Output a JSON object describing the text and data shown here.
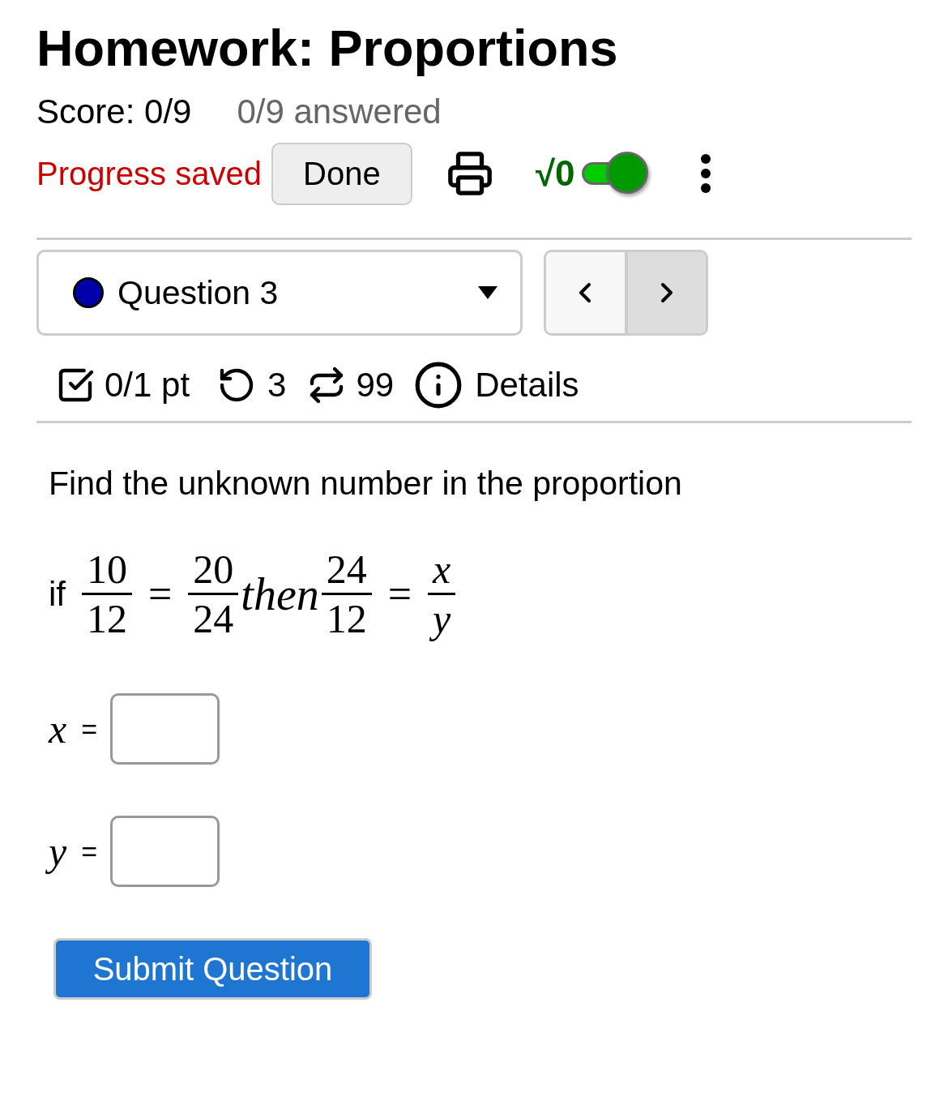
{
  "header": {
    "title": "Homework: Proportions",
    "score": "Score: 0/9",
    "answered": "0/9 answered"
  },
  "toolbar": {
    "status": "Progress saved",
    "done_button": "Done",
    "math_toggle": {
      "label": "√0",
      "on": true
    }
  },
  "question_nav": {
    "dropdown": {
      "label": "Question 3",
      "color": "#0000aa"
    }
  },
  "question_info": {
    "points": "0/1 pt",
    "retries": "3",
    "attempts": "99",
    "details": "Details"
  },
  "question": {
    "prompt": "Find the unknown number in the proportion",
    "expression": [
      {
        "kind": "text",
        "text": "if"
      },
      {
        "kind": "fraction",
        "numerator": "10",
        "denominator": "12"
      },
      {
        "kind": "operator",
        "text": "="
      },
      {
        "kind": "fraction",
        "numerator": "20",
        "denominator": "24"
      },
      {
        "kind": "italic_text",
        "text": "then"
      },
      {
        "kind": "fraction",
        "numerator": "24",
        "denominator": "12"
      },
      {
        "kind": "operator",
        "text": "="
      },
      {
        "kind": "variable_fraction",
        "numerator": "x",
        "denominator": "y"
      }
    ],
    "answers": [
      {
        "variable": "x",
        "sign": "="
      },
      {
        "variable": "y",
        "sign": "="
      }
    ],
    "submit_button": "Submit Question"
  }
}
